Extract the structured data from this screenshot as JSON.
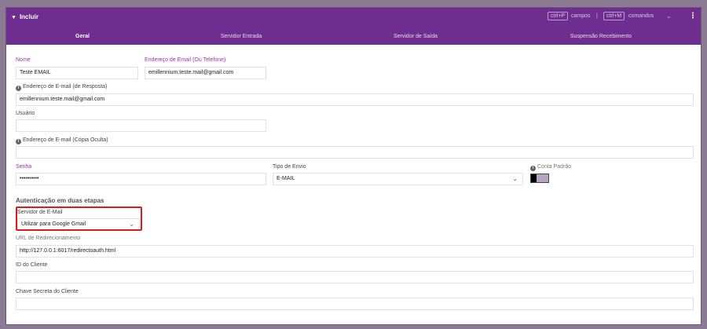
{
  "header": {
    "title": "Incluir",
    "shortcut_fields_key": "ctrl+P",
    "shortcut_fields_label": "campos",
    "separator": "|",
    "shortcut_commands_key": "ctrl+M",
    "shortcut_commands_label": "comandos"
  },
  "tabs": [
    {
      "label": "Geral",
      "active": true
    },
    {
      "label": "Servidor Entrada",
      "active": false
    },
    {
      "label": "Servidor de Saída",
      "active": false
    },
    {
      "label": "Suspensão Recebimento",
      "active": false
    }
  ],
  "form": {
    "nome_label": "Nome",
    "nome_value": "Teste EMAIL",
    "email_label": "Endereço de Email (Ou Telefone)",
    "email_value": "emillennium.teste.mail@gmail.com",
    "reply_label": "Endereço de E-mail (de Resposta)",
    "reply_value": "emillennium.teste.mail@gmail.com",
    "usuario_label": "Usuário",
    "usuario_value": "",
    "bcc_label": "Endereço de E-mail (Cópia Oculta)",
    "bcc_value": "",
    "senha_label": "Senha",
    "senha_value": "••••••••••",
    "tipo_label": "Tipo de Envio",
    "tipo_value": "E-MAIL",
    "conta_label": "Conta Padrão",
    "section_title": "Autenticação em duas etapas",
    "servidor_label": "Servidor de E-Mail",
    "servidor_value": "Utilizar para Google Gmail",
    "url_label": "URL de Redirecionamento",
    "url_value": "http://127.0.0.1:6017/redirectoauth.html",
    "client_id_label": "ID do Cliente",
    "client_id_value": "",
    "client_secret_label": "Chave Secreta do Cliente",
    "client_secret_value": ""
  },
  "colors": {
    "header": "#6e2e8f",
    "label_required": "#9c33b0",
    "highlight": "#e01a1a"
  }
}
